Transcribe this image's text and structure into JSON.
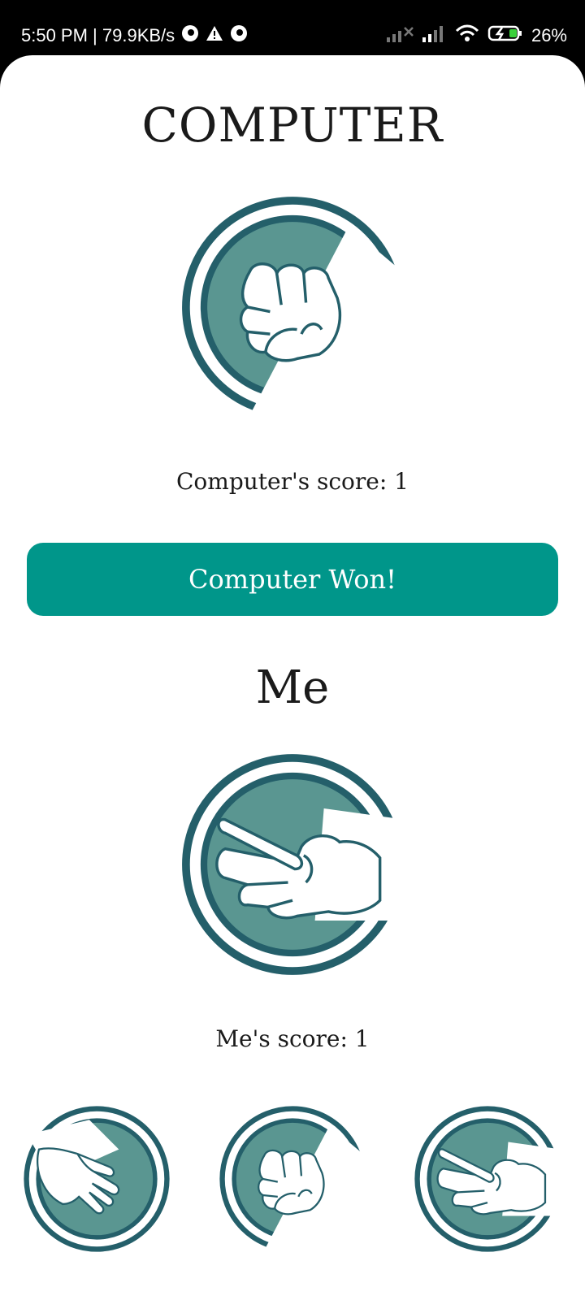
{
  "status_bar": {
    "time_speed": "5:50 PM | 79.9KB/s",
    "battery": "26%",
    "icons": [
      "app-icon",
      "warning-icon",
      "app-icon",
      "signal-icon",
      "signal-icon",
      "wifi-icon",
      "battery-charging-icon"
    ]
  },
  "computer": {
    "title": "COMPUTER",
    "choice_icon": "rock-fist-icon",
    "score_text": "Computer's score: 1"
  },
  "result": {
    "label": "Computer Won!",
    "color": "#00968a"
  },
  "me": {
    "title": "Me",
    "choice_icon": "scissors-hand-icon",
    "score_text": "Me's score: 1"
  },
  "choices": [
    {
      "name": "paper",
      "icon": "paper-hand-icon"
    },
    {
      "name": "rock",
      "icon": "rock-fist-icon"
    },
    {
      "name": "scissors",
      "icon": "scissors-hand-icon"
    }
  ],
  "colors": {
    "ring": "#245f6a",
    "fill": "#5a9691",
    "accent": "#00968a"
  }
}
